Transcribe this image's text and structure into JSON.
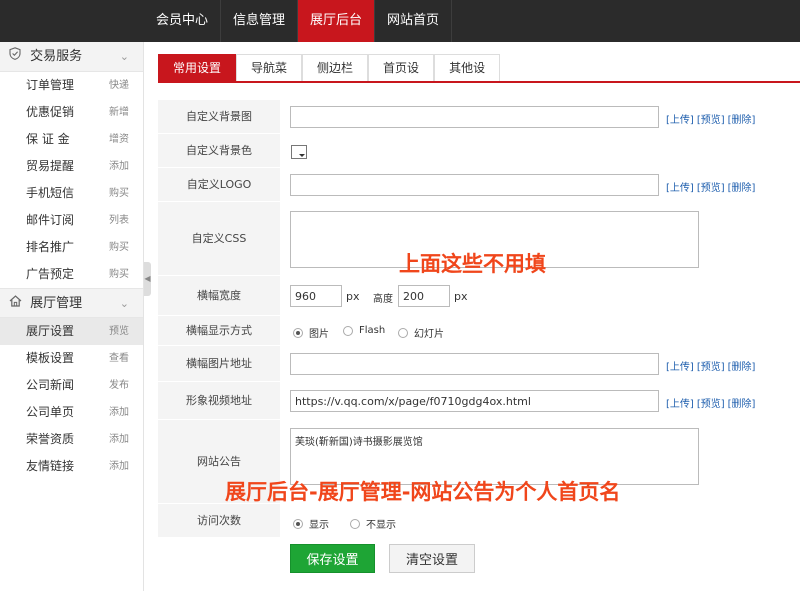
{
  "topnav": [
    {
      "label": "会员中心",
      "active": false
    },
    {
      "label": "信息管理",
      "active": false
    },
    {
      "label": "展厅后台",
      "active": true
    },
    {
      "label": "网站首页",
      "active": false
    }
  ],
  "sidebar": {
    "groups": [
      {
        "title": "交易服务",
        "icon": "shield-check-icon",
        "items": [
          {
            "label": "订单管理",
            "tag": "快递"
          },
          {
            "label": "优惠促销",
            "tag": "新增"
          },
          {
            "label": "保 证 金",
            "tag": "增资"
          },
          {
            "label": "贸易提醒",
            "tag": "添加"
          },
          {
            "label": "手机短信",
            "tag": "购买"
          },
          {
            "label": "邮件订阅",
            "tag": "列表"
          },
          {
            "label": "排名推广",
            "tag": "购买"
          },
          {
            "label": "广告预定",
            "tag": "购买"
          }
        ]
      },
      {
        "title": "展厅管理",
        "icon": "home-icon",
        "items": [
          {
            "label": "展厅设置",
            "tag": "预览",
            "active": true
          },
          {
            "label": "模板设置",
            "tag": "查看"
          },
          {
            "label": "公司新闻",
            "tag": "发布"
          },
          {
            "label": "公司单页",
            "tag": "添加"
          },
          {
            "label": "荣誉资质",
            "tag": "添加"
          },
          {
            "label": "友情链接",
            "tag": "添加"
          }
        ]
      }
    ]
  },
  "tabs": [
    {
      "label": "常用设置",
      "active": true
    },
    {
      "label": "导航菜",
      "active": false
    },
    {
      "label": "侧边栏",
      "active": false
    },
    {
      "label": "首页设",
      "active": false
    },
    {
      "label": "其他设",
      "active": false
    }
  ],
  "form": {
    "bg_image_label": "自定义背景图",
    "bg_color_label": "自定义背景色",
    "logo_label": "自定义LOGO",
    "css_label": "自定义CSS",
    "banner_size_label": "横幅宽度",
    "banner_width": "960",
    "banner_height_label": "高度",
    "banner_height": "200",
    "unit_px": "px",
    "banner_mode_label": "横幅显示方式",
    "banner_modes": [
      {
        "label": "图片",
        "checked": true
      },
      {
        "label": "Flash",
        "checked": false
      },
      {
        "label": "幻灯片",
        "checked": false
      }
    ],
    "banner_image_label": "横幅图片地址",
    "video_label": "形象视频地址",
    "video_url": "https://v.qq.com/x/page/f0710gdg4ox.html",
    "notice_label": "网站公告",
    "notice_text": "芙琰(靳新国)诗书摄影展览馆",
    "visits_label": "访问次数",
    "visit_options": [
      {
        "label": "显示",
        "checked": true
      },
      {
        "label": "不显示",
        "checked": false
      }
    ],
    "link_upload": "[上传]",
    "link_preview": "[预览]",
    "link_delete": "[删除]"
  },
  "buttons": {
    "save": "保存设置",
    "clear": "清空设置"
  },
  "annotations": {
    "note1": "上面这些不用填",
    "note2": "展厅后台-展厅管理-网站公告为个人首页名"
  },
  "colors": {
    "accent": "#c8161d",
    "save_button": "#1ea535",
    "annotation": "#f0461b",
    "link": "#1f5fae"
  }
}
